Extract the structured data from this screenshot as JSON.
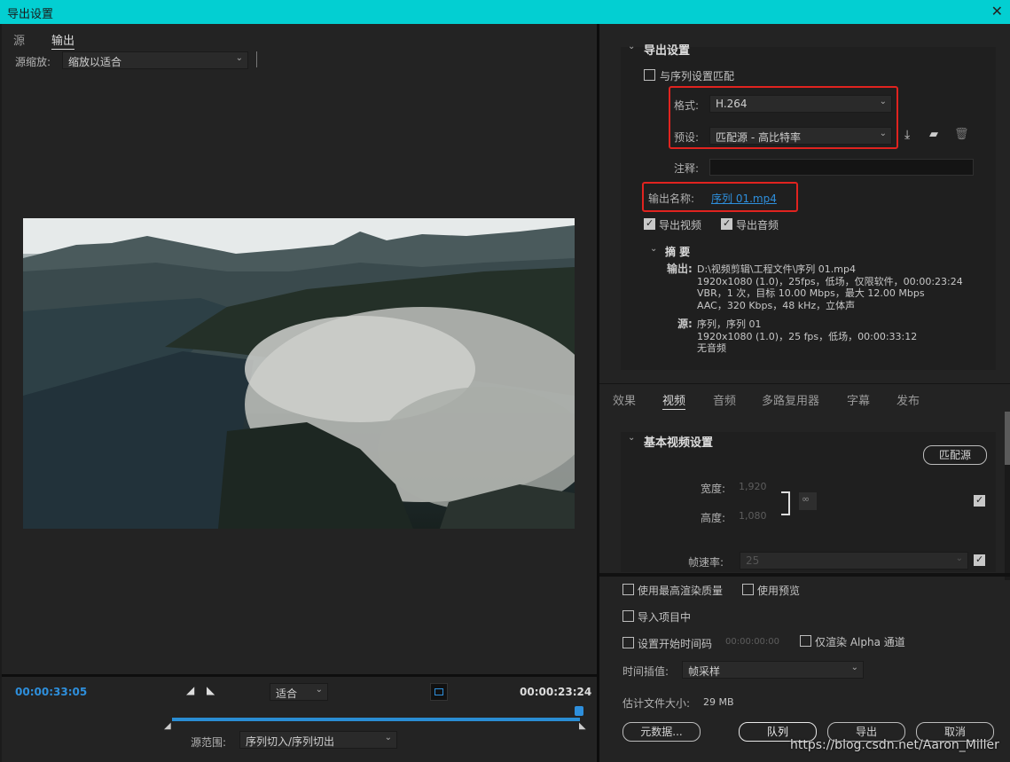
{
  "window": {
    "title": "导出设置",
    "close": "✕"
  },
  "left": {
    "tabs": [
      {
        "label": "源"
      },
      {
        "label": "输出"
      }
    ],
    "zoom_label": "源缩放:",
    "zoom_value": "缩放以适合",
    "timecode_start": "00:00:33:05",
    "fit_value": "适合",
    "timecode_end": "00:00:23:24",
    "source_range_label": "源范围:",
    "source_range_value": "序列切入/序列切出"
  },
  "export": {
    "section_title": "导出设置",
    "match_sequence": "与序列设置匹配",
    "format_label": "格式:",
    "format_value": "H.264",
    "preset_label": "预设:",
    "preset_value": "匹配源 - 高比特率",
    "comment_label": "注释:",
    "output_name_label": "输出名称:",
    "output_name_value": "序列 01.mp4",
    "export_video": "导出视频",
    "export_audio": "导出音频",
    "summary_title": "摘 要",
    "output_label": "输出:",
    "output_lines": [
      "D:\\视频剪辑\\工程文件\\序列 01.mp4",
      "1920x1080 (1.0)，25fps，低场，仅限软件，00:00:23:24",
      "VBR，1 次，目标 10.00 Mbps，最大 12.00 Mbps",
      "AAC，320 Kbps，48  kHz，立体声"
    ],
    "source_label": "源:",
    "source_lines": [
      "序列，序列 01",
      "1920x1080 (1.0)，25 fps，低场，00:00:33:12",
      "无音频"
    ]
  },
  "settings_tabs": [
    {
      "label": "效果"
    },
    {
      "label": "视频"
    },
    {
      "label": "音频"
    },
    {
      "label": "多路复用器"
    },
    {
      "label": "字幕"
    },
    {
      "label": "发布"
    }
  ],
  "video": {
    "section_title": "基本视频设置",
    "match_source": "匹配源",
    "width_label": "宽度:",
    "width_value": "1,920",
    "height_label": "高度:",
    "height_value": "1,080",
    "fps_label": "帧速率:",
    "fps_value": "25"
  },
  "bottom": {
    "max_render": "使用最高渲染质量",
    "use_preview": "使用预览",
    "import_project": "导入项目中",
    "set_timecode": "设置开始时间码",
    "timecode_value": "00:00:00:00",
    "alpha_only": "仅渲染 Alpha 通道",
    "interp_label": "时间插值:",
    "interp_value": "帧采样",
    "filesize_label": "估计文件大小:",
    "filesize_value": "29 MB",
    "metadata_button": "元数据...",
    "queue_button": "队列",
    "export_button": "导出",
    "cancel_button": "取消"
  },
  "watermark": "https://blog.csdn.net/Aaron_Miller"
}
